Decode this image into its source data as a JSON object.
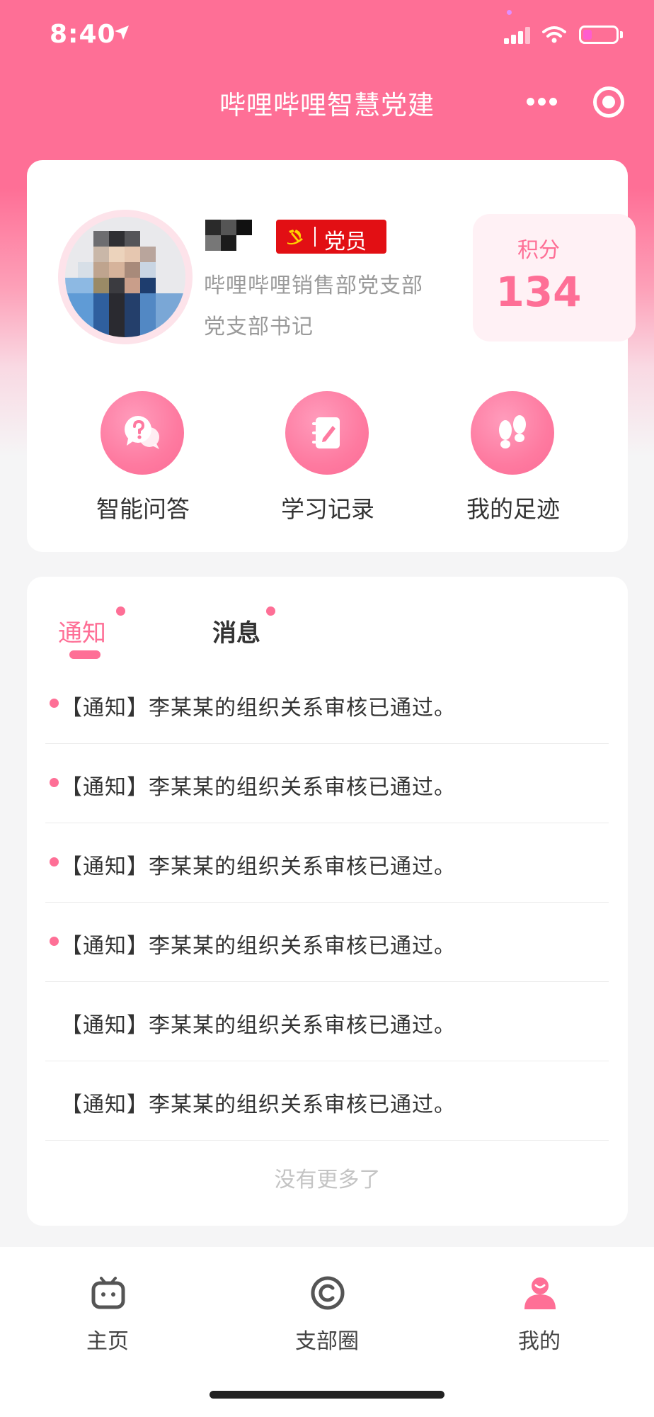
{
  "status_bar": {
    "time": "8:40"
  },
  "nav": {
    "title": "哔哩哔哩智慧党建"
  },
  "profile": {
    "badge": "党员",
    "department": "哔哩哔哩销售部党支部",
    "role": "党支部书记",
    "points_label": "积分",
    "points_value": "134"
  },
  "quick_actions": [
    {
      "label": "智能问答",
      "icon": "question-chat-icon"
    },
    {
      "label": "学习记录",
      "icon": "notebook-icon"
    },
    {
      "label": "我的足迹",
      "icon": "footprints-icon"
    }
  ],
  "message_tabs": [
    {
      "label": "通知",
      "active": true,
      "has_dot": true
    },
    {
      "label": "消息",
      "active": false,
      "has_dot": true
    }
  ],
  "notifications": [
    {
      "text": "【通知】李某某的组织关系审核已通过。",
      "unread": true
    },
    {
      "text": "【通知】李某某的组织关系审核已通过。",
      "unread": true
    },
    {
      "text": "【通知】李某某的组织关系审核已通过。",
      "unread": true
    },
    {
      "text": "【通知】李某某的组织关系审核已通过。",
      "unread": true
    },
    {
      "text": "【通知】李某某的组织关系审核已通过。",
      "unread": false
    },
    {
      "text": "【通知】李某某的组织关系审核已通过。",
      "unread": false
    }
  ],
  "list_end_text": "没有更多了",
  "tabbar": [
    {
      "label": "主页",
      "icon": "tv-icon",
      "active": false
    },
    {
      "label": "支部圈",
      "icon": "circle-c-icon",
      "active": false
    },
    {
      "label": "我的",
      "icon": "user-icon",
      "active": true
    }
  ],
  "colors": {
    "accent": "#fe6f96",
    "party_red": "#e20f14",
    "text_primary": "#333333",
    "text_secondary": "#9a9a9a"
  }
}
